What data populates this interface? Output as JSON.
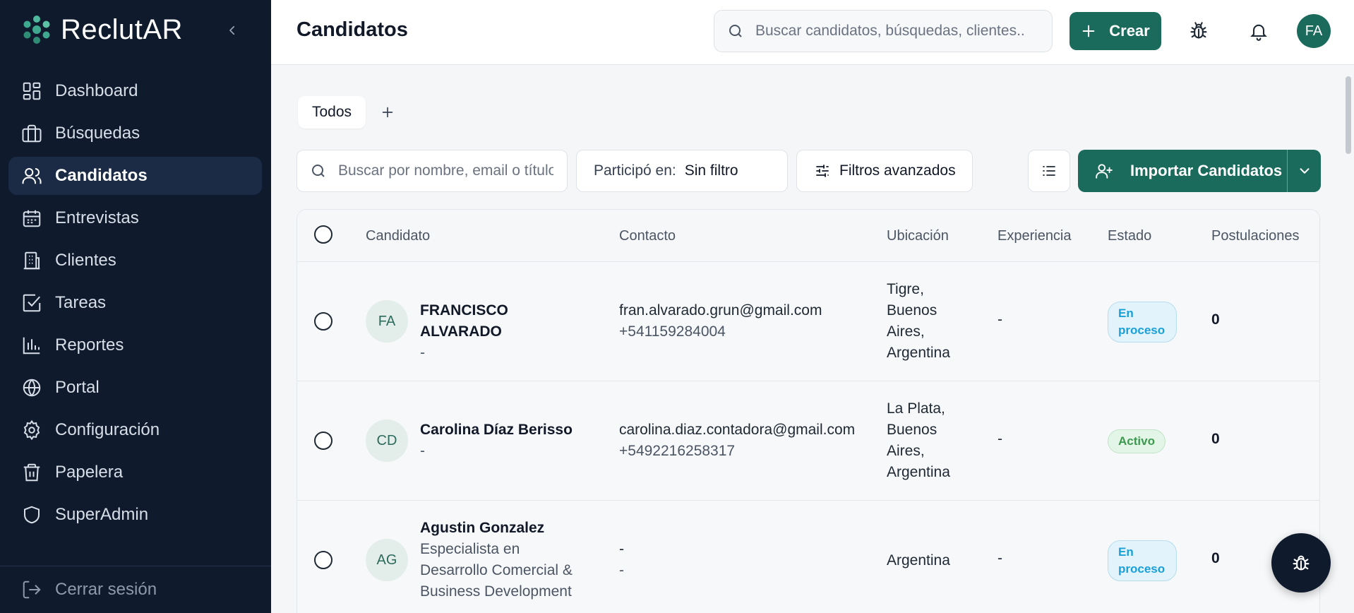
{
  "brand": {
    "name": "ReclutAR"
  },
  "sidebar": {
    "items": [
      {
        "label": "Dashboard",
        "icon": "dashboard-icon"
      },
      {
        "label": "Búsquedas",
        "icon": "briefcase-icon"
      },
      {
        "label": "Candidatos",
        "icon": "users-icon",
        "active": true
      },
      {
        "label": "Entrevistas",
        "icon": "calendar-icon"
      },
      {
        "label": "Clientes",
        "icon": "building-icon"
      },
      {
        "label": "Tareas",
        "icon": "checkbox-icon"
      },
      {
        "label": "Reportes",
        "icon": "bar-chart-icon"
      },
      {
        "label": "Portal",
        "icon": "globe-icon"
      },
      {
        "label": "Configuración",
        "icon": "gear-icon"
      },
      {
        "label": "Papelera",
        "icon": "trash-icon"
      },
      {
        "label": "SuperAdmin",
        "icon": "shield-icon"
      }
    ],
    "logout": "Cerrar sesión"
  },
  "header": {
    "title": "Candidatos",
    "search_placeholder": "Buscar candidatos, búsquedas, clientes...",
    "create_label": "Crear",
    "avatar_initials": "FA"
  },
  "tabs": {
    "items": [
      "Todos"
    ]
  },
  "toolbar": {
    "search_placeholder": "Buscar por nombre, email o título",
    "participo_label": "Participó en:",
    "participo_value": "Sin filtro",
    "filters_label": "Filtros avanzados",
    "import_label": "Importar Candidatos"
  },
  "table": {
    "columns": [
      "Candidato",
      "Contacto",
      "Ubicación",
      "Experiencia",
      "Estado",
      "Postulaciones"
    ],
    "rows": [
      {
        "initials": "FA",
        "name": "FRANCISCO ALVARADO",
        "title_lines": [
          "-"
        ],
        "email": "fran.alvarado.grun@gmail.com",
        "phone": "+541159284004",
        "location_lines": [
          "Tigre,",
          "Buenos",
          "Aires,",
          "Argentina"
        ],
        "experience": "-",
        "status_lines": [
          "En",
          "proceso"
        ],
        "status_type": "proceso",
        "applications": "0"
      },
      {
        "initials": "CD",
        "name": "Carolina Díaz Berisso",
        "title_lines": [
          "-"
        ],
        "email": "carolina.diaz.contadora@gmail.com",
        "phone": "+5492216258317",
        "location_lines": [
          "La Plata,",
          "Buenos",
          "Aires,",
          "Argentina"
        ],
        "experience": "-",
        "status_lines": [
          "Activo"
        ],
        "status_type": "activo",
        "applications": "0"
      },
      {
        "initials": "AG",
        "name": "Agustin Gonzalez",
        "title_lines": [
          "Especialista en",
          "Desarrollo Comercial &",
          "Business Development"
        ],
        "email": "-",
        "phone": "-",
        "location_lines": [
          "Argentina"
        ],
        "experience": "-",
        "status_lines": [
          "En",
          "proceso"
        ],
        "status_type": "proceso",
        "applications": "0"
      }
    ]
  },
  "colors": {
    "sidebar_bg": "#0f1b2d",
    "accent": "#1b6b5d",
    "status_proceso": "#1aa0d8",
    "status_activo": "#3c9a4e"
  }
}
